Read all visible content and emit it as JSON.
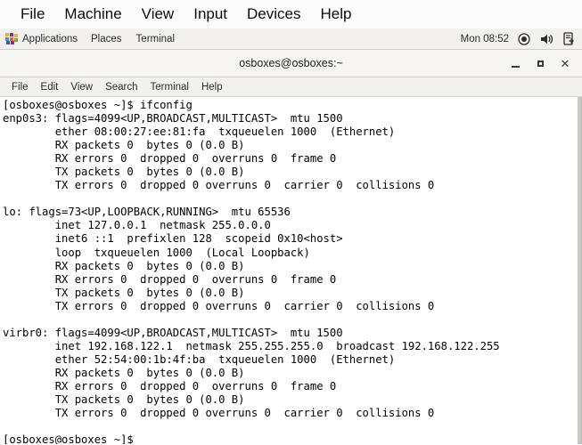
{
  "vbox_menubar": {
    "items": [
      {
        "label": "File",
        "name": "vbox-menu-file"
      },
      {
        "label": "Machine",
        "name": "vbox-menu-machine"
      },
      {
        "label": "View",
        "name": "vbox-menu-view"
      },
      {
        "label": "Input",
        "name": "vbox-menu-input"
      },
      {
        "label": "Devices",
        "name": "vbox-menu-devices"
      },
      {
        "label": "Help",
        "name": "vbox-menu-help"
      }
    ]
  },
  "gnome_panel": {
    "applications_label": "Applications",
    "places_label": "Places",
    "terminal_label": "Terminal",
    "clock": "Mon 08:52",
    "tray_icons": [
      "record-circle-icon",
      "volume-speaker-icon",
      "system-update-icon"
    ],
    "apps_icon": "applications-grid-icon"
  },
  "terminal_window": {
    "title": "osboxes@osboxes:~",
    "controls": {
      "minimize": "minimize-button",
      "maximize": "maximize-button",
      "close": "✕"
    },
    "menubar": [
      {
        "label": "File",
        "name": "term-menu-file"
      },
      {
        "label": "Edit",
        "name": "term-menu-edit"
      },
      {
        "label": "View",
        "name": "term-menu-view"
      },
      {
        "label": "Search",
        "name": "term-menu-search"
      },
      {
        "label": "Terminal",
        "name": "term-menu-terminal"
      },
      {
        "label": "Help",
        "name": "term-menu-help"
      }
    ],
    "prompt": "[osboxes@osboxes ~]$",
    "command": "ifconfig",
    "content": "[osboxes@osboxes ~]$ ifconfig\nenp0s3: flags=4099<UP,BROADCAST,MULTICAST>  mtu 1500\n        ether 08:00:27:ee:81:fa  txqueuelen 1000  (Ethernet)\n        RX packets 0  bytes 0 (0.0 B)\n        RX errors 0  dropped 0  overruns 0  frame 0\n        TX packets 0  bytes 0 (0.0 B)\n        TX errors 0  dropped 0 overruns 0  carrier 0  collisions 0\n\nlo: flags=73<UP,LOOPBACK,RUNNING>  mtu 65536\n        inet 127.0.0.1  netmask 255.0.0.0\n        inet6 ::1  prefixlen 128  scopeid 0x10<host>\n        loop  txqueuelen 1000  (Local Loopback)\n        RX packets 0  bytes 0 (0.0 B)\n        RX errors 0  dropped 0  overruns 0  frame 0\n        TX packets 0  bytes 0 (0.0 B)\n        TX errors 0  dropped 0 overruns 0  carrier 0  collisions 0\n\nvirbr0: flags=4099<UP,BROADCAST,MULTICAST>  mtu 1500\n        inet 192.168.122.1  netmask 255.255.255.0  broadcast 192.168.122.255\n        ether 52:54:00:1b:4f:ba  txqueuelen 1000  (Ethernet)\n        RX packets 0  bytes 0 (0.0 B)\n        RX errors 0  dropped 0  overruns 0  frame 0\n        TX packets 0  bytes 0 (0.0 B)\n        TX errors 0  dropped 0 overruns 0  carrier 0  collisions 0\n\n[osboxes@osboxes ~]$"
  },
  "colors": {
    "panel_bg": "#f2f1f0",
    "titlebar_bg": "#f7f6f5",
    "terminal_bg": "#ffffff",
    "terminal_fg": "#000000",
    "menubar_bg": "#fcfcfc"
  }
}
